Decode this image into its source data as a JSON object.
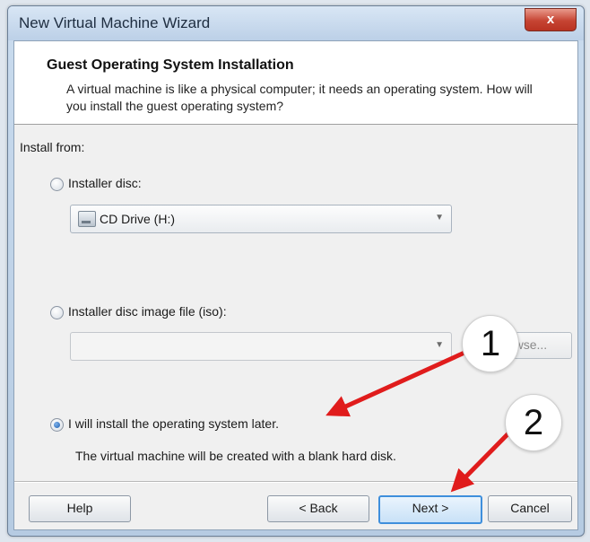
{
  "window": {
    "title": "New Virtual Machine Wizard",
    "close_glyph": "x"
  },
  "header": {
    "title": "Guest Operating System Installation",
    "description": "A virtual machine is like a physical computer; it needs an operating system. How will you install the guest operating system?"
  },
  "install_from_label": "Install from:",
  "options": {
    "installer_disc": {
      "label": "Installer disc:",
      "selected": false,
      "drive_value": "CD Drive (H:)",
      "drive_icon": "cd-drive-icon"
    },
    "iso_file": {
      "label": "Installer disc image file (iso):",
      "selected": false,
      "path_value": "",
      "browse_label": "Browse..."
    },
    "install_later": {
      "label": "I will install the operating system later.",
      "selected": true,
      "note": "The virtual machine will be created with a blank hard disk."
    }
  },
  "buttons": {
    "help": "Help",
    "back": "< Back",
    "next": "Next >",
    "cancel": "Cancel"
  },
  "annotations": {
    "badge_1": "1",
    "badge_2": "2",
    "arrow_color": "#e01c1c"
  }
}
